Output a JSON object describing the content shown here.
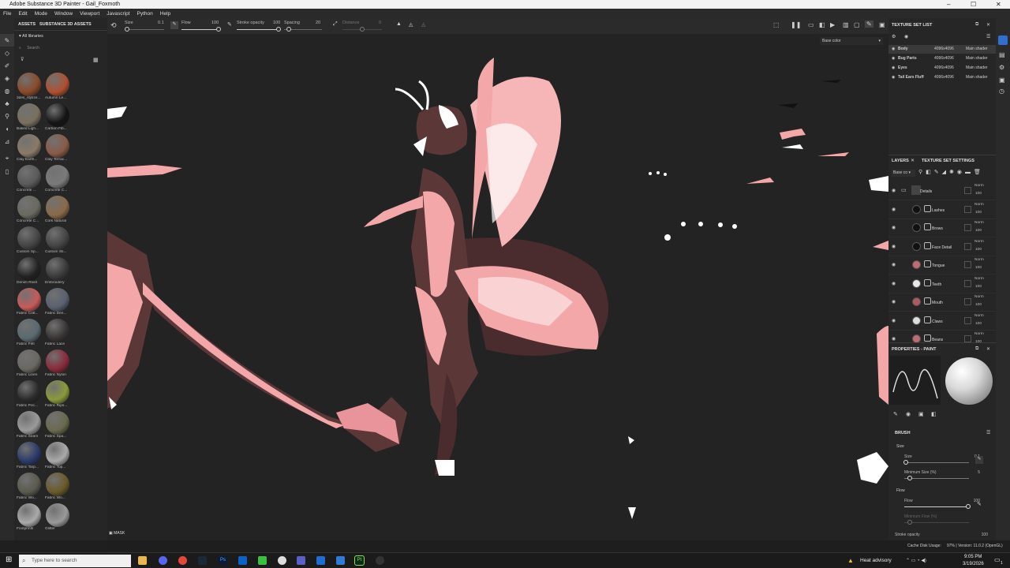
{
  "titlebar": {
    "title": "Adobe Substance 3D Painter - Gail_Foxmoth"
  },
  "menu": [
    "File",
    "Edit",
    "Mode",
    "Window",
    "Viewport",
    "Javascript",
    "Python",
    "Help"
  ],
  "toolbar": {
    "size": {
      "label": "Size",
      "value": "0.1"
    },
    "flow": {
      "label": "Flow",
      "value": "100"
    },
    "stroke_opacity": {
      "label": "Stroke opacity",
      "value": "100"
    },
    "spacing": {
      "label": "Spacing",
      "value": "20"
    },
    "distance": {
      "label": "Distance",
      "value": "0"
    }
  },
  "viewport": {
    "channel_select": "Base color",
    "mask_label": "MASK"
  },
  "assets": {
    "tab1": "ASSETS",
    "tab2": "SUBSTANCE 3D ASSETS",
    "library": "All libraries",
    "search_placeholder": "Search",
    "items": [
      {
        "label": "3des_stylize...",
        "color": "#8a4a2a"
      },
      {
        "label": "Autumn Le...",
        "color": "#b05030"
      },
      {
        "label": "Baked Ligh...",
        "color": "#7a7060"
      },
      {
        "label": "Carbon Fib...",
        "color": "#151515"
      },
      {
        "label": "Clay Earth...",
        "color": "#8a7a68"
      },
      {
        "label": "Clay Terrac...",
        "color": "#8a5a48"
      },
      {
        "label": "Concrete ...",
        "color": "#5a5a5a"
      },
      {
        "label": "Concrete C...",
        "color": "#7a7a7a"
      },
      {
        "label": "Concrete C...",
        "color": "#6a6a62"
      },
      {
        "label": "Cork Natural",
        "color": "#8a6a48"
      },
      {
        "label": "Custom Sp...",
        "color": "#444444"
      },
      {
        "label": "Custom Sti...",
        "color": "#444444"
      },
      {
        "label": "Denim Rivet",
        "color": "#222222"
      },
      {
        "label": "Embroidery",
        "color": "#3a3a3a"
      },
      {
        "label": "Fabric Cott...",
        "color": "#c85a5a"
      },
      {
        "label": "Fabric Den...",
        "color": "#5a6070"
      },
      {
        "label": "Fabric Felt",
        "color": "#5a6a70"
      },
      {
        "label": "Fabric Lace",
        "color": "#3a3535"
      },
      {
        "label": "Fabric Linen",
        "color": "#6a6862"
      },
      {
        "label": "Fabric Nylon",
        "color": "#8a2a3a"
      },
      {
        "label": "Fabric Poc...",
        "color": "#2a2a2a"
      },
      {
        "label": "Fabric Rips...",
        "color": "#8a9a3a"
      },
      {
        "label": "Fabric Seam",
        "color": "#9a9a9a"
      },
      {
        "label": "Fabric Spa...",
        "color": "#6a6a50"
      },
      {
        "label": "Fabric Tarp...",
        "color": "#2a3a6a"
      },
      {
        "label": "Fabric Top...",
        "color": "#aaaaaa"
      },
      {
        "label": "Fabric Wo...",
        "color": "#5a5a50"
      },
      {
        "label": "Fabric Wo...",
        "color": "#6a5a2a"
      },
      {
        "label": "Footprints",
        "color": "#aaaaaa"
      },
      {
        "label": "Glitter",
        "color": "#999999"
      }
    ]
  },
  "texture_set_list": {
    "title": "TEXTURE SET LIST",
    "rows": [
      {
        "name": "Body",
        "res": "4096x4096",
        "shader": "Main shader"
      },
      {
        "name": "Bug Parts",
        "res": "4096x4096",
        "shader": "Main shader"
      },
      {
        "name": "Eyes",
        "res": "4096x4096",
        "shader": "Main shader"
      },
      {
        "name": "Tail Ears Fluff",
        "res": "4096x4096",
        "shader": "Main shader"
      }
    ]
  },
  "layers": {
    "tab1": "LAYERS",
    "tab2": "TEXTURE SET SETTINGS",
    "channel": "Base co",
    "rows": [
      {
        "name": "Details",
        "blend": "Norm",
        "opacity": "100",
        "color": "#444444"
      },
      {
        "name": "Lashes",
        "blend": "Norm",
        "opacity": "100",
        "color": "#111111"
      },
      {
        "name": "Brows",
        "blend": "Norm",
        "opacity": "100",
        "color": "#111111"
      },
      {
        "name": "Face Detail",
        "blend": "Norm",
        "opacity": "100",
        "color": "#111111"
      },
      {
        "name": "Tongue",
        "blend": "Norm",
        "opacity": "100",
        "color": "#c06a72"
      },
      {
        "name": "Teeth",
        "blend": "Norm",
        "opacity": "100",
        "color": "#e8e8e8"
      },
      {
        "name": "Mouth",
        "blend": "Norm",
        "opacity": "100",
        "color": "#b05a60"
      },
      {
        "name": "Claws",
        "blend": "Norm",
        "opacity": "100",
        "color": "#dddddd"
      },
      {
        "name": "Beans",
        "blend": "Norm",
        "opacity": "100",
        "color": "#c06a72"
      }
    ]
  },
  "properties": {
    "title": "PROPERTIES - PAINT",
    "section": "BRUSH",
    "size_group": "Size",
    "size": {
      "label": "Size",
      "value": "0.1"
    },
    "min_size": {
      "label": "Minimum Size (%)",
      "value": "5"
    },
    "flow_group": "Flow",
    "flow": {
      "label": "Flow",
      "value": "100"
    },
    "min_flow": {
      "label": "Minimum Flow (%)"
    },
    "stroke_opacity": {
      "label": "Stroke opacity",
      "value": "100"
    }
  },
  "status": {
    "text": "Cache Disk Usage:",
    "value": "97% | Version: 11.0.2 (OpenGL)"
  },
  "taskbar": {
    "search_placeholder": "Type here to search",
    "weather": "Heat advisory",
    "time": "9:05 PM",
    "date": "3/19/2026",
    "notif": "1"
  }
}
